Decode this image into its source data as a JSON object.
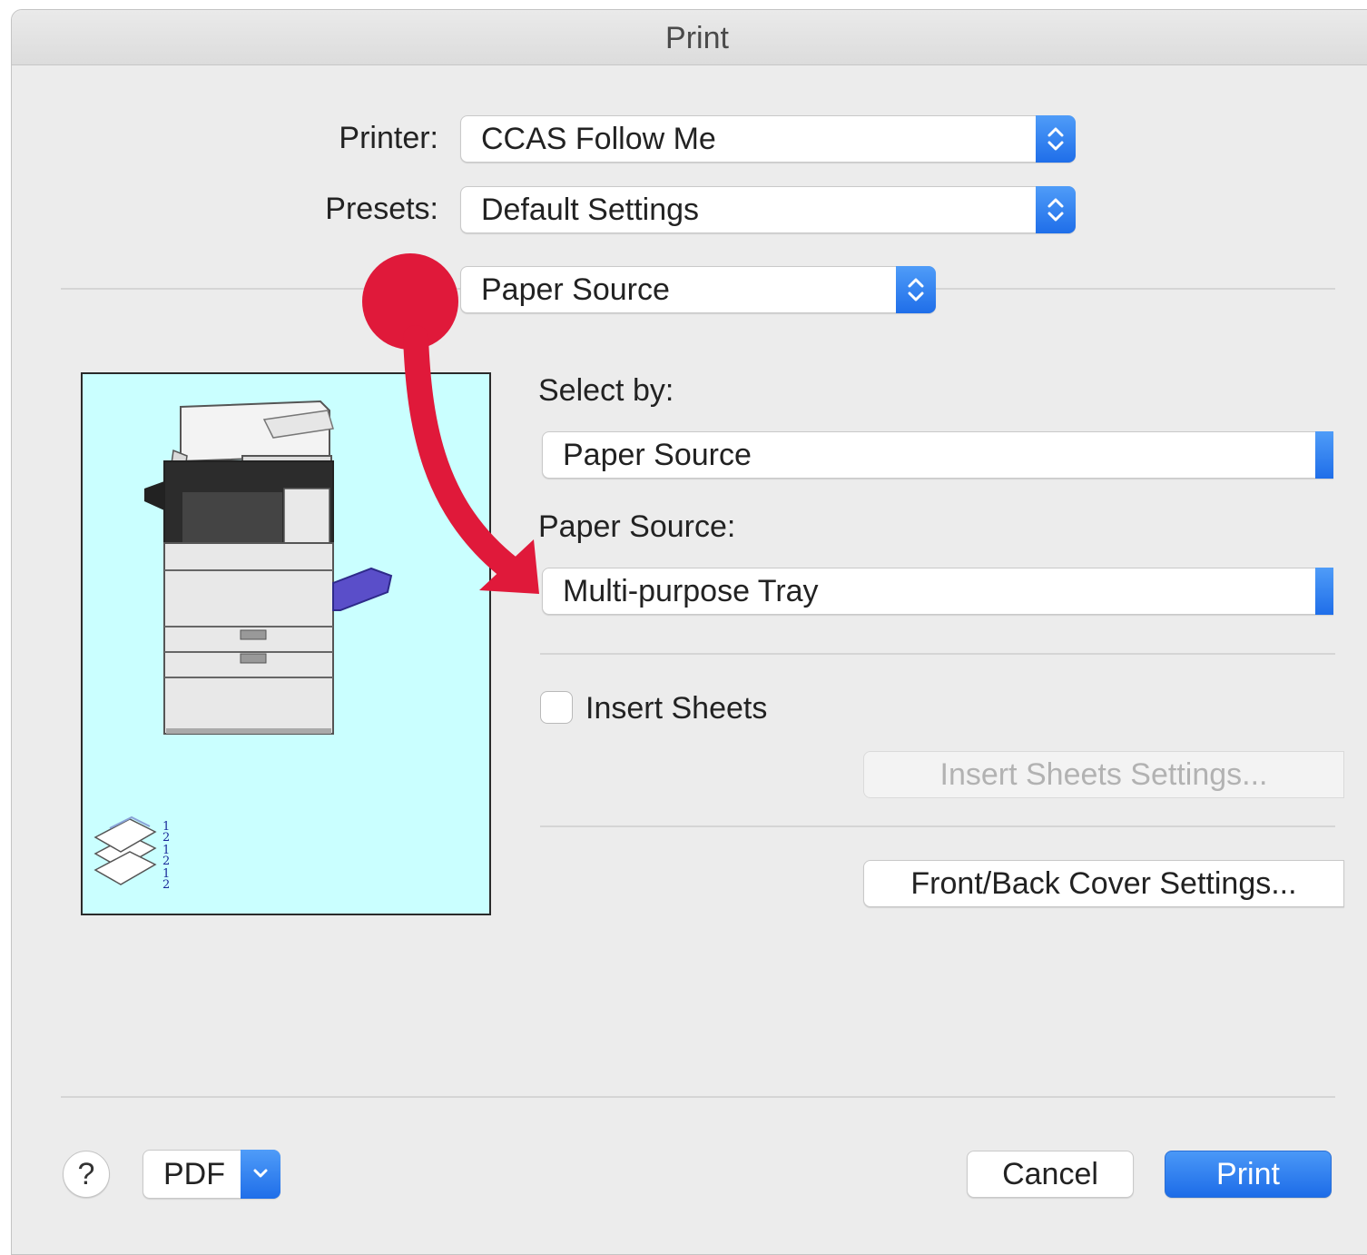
{
  "window": {
    "title": "Print"
  },
  "printer": {
    "label": "Printer:",
    "value": "CCAS Follow Me"
  },
  "presets": {
    "label": "Presets:",
    "value": "Default Settings"
  },
  "panel_menu": {
    "value": "Paper Source"
  },
  "select_by": {
    "label": "Select by:",
    "value": "Paper Source"
  },
  "paper_source": {
    "label": "Paper Source:",
    "value": "Multi-purpose Tray"
  },
  "insert_sheets": {
    "label": "Insert Sheets",
    "checked": false
  },
  "buttons": {
    "insert_sheets_settings": "Insert Sheets Settings...",
    "cover_settings": "Front/Back Cover Settings...",
    "help": "?",
    "pdf": "PDF",
    "cancel": "Cancel",
    "print": "Print"
  },
  "preview": {
    "collate_digits": [
      "1",
      "2",
      "1",
      "2",
      "1",
      "2"
    ]
  },
  "colors": {
    "accent": "#1f6ee9",
    "preview_bg": "#caffff",
    "annotation": "#e0193a"
  },
  "icons": {
    "stepper": "up-down-chevron-icon",
    "pdf_menu": "chevron-down-icon",
    "printer_preview": "copier-illustration",
    "output": "collated-stack-icon",
    "annotation": "red-curved-arrow"
  }
}
